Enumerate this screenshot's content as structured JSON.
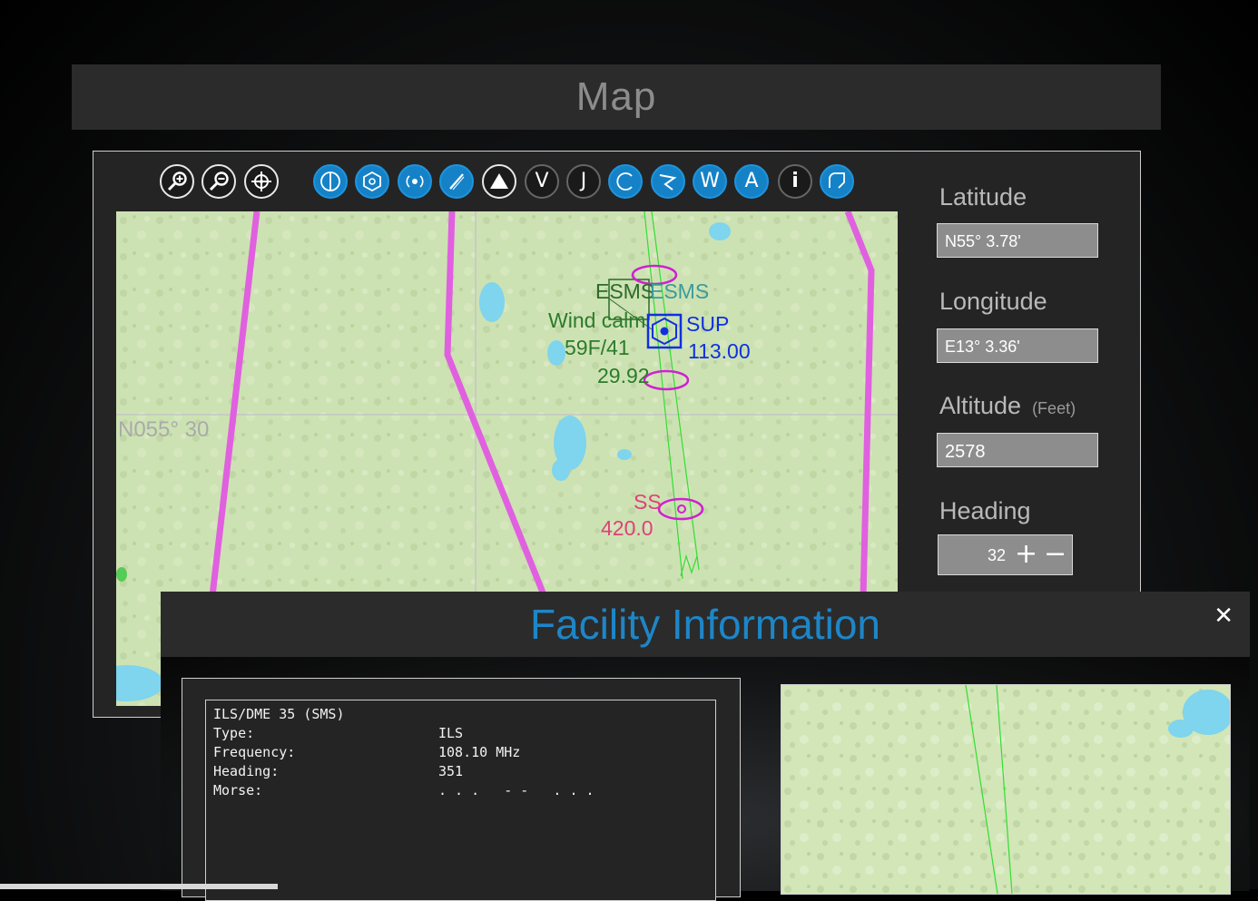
{
  "map_window": {
    "title": "Map"
  },
  "toolbar": {
    "buttons": [
      {
        "name": "zoom-in",
        "glyph": "⊕"
      },
      {
        "name": "zoom-out",
        "glyph": "⊖"
      },
      {
        "name": "center",
        "glyph": "⌖"
      },
      {
        "name": "layer-a",
        "glyph": "◐"
      },
      {
        "name": "layer-vor",
        "glyph": "⬡"
      },
      {
        "name": "layer-ndb",
        "glyph": "◉"
      },
      {
        "name": "layer-airport",
        "glyph": "✈"
      },
      {
        "name": "layer-aircraft",
        "glyph": "▲"
      },
      {
        "name": "layer-v",
        "glyph": "V"
      },
      {
        "name": "layer-j",
        "glyph": "J"
      },
      {
        "name": "layer-c",
        "glyph": "C"
      },
      {
        "name": "layer-route",
        "glyph": "⇝"
      },
      {
        "name": "layer-w",
        "glyph": "W"
      },
      {
        "name": "layer-a2",
        "glyph": "A"
      },
      {
        "name": "info",
        "glyph": "i"
      },
      {
        "name": "layer-arc",
        "glyph": "↻"
      }
    ]
  },
  "map_labels": {
    "grid_lat": "N055° 30",
    "airport_code_left": "ESMS",
    "airport_code_right": "ESMS",
    "weather_wind": "Wind calm",
    "weather_temp": "59F/41",
    "weather_pressure": "29.92",
    "vor_name": "SUP",
    "vor_freq": "113.00",
    "ndb_name": "SS",
    "ndb_freq": "420.0"
  },
  "fields": {
    "latitude": {
      "label": "Latitude",
      "value": "N55° 3.78'"
    },
    "longitude": {
      "label": "Longitude",
      "value": "E13° 3.36'"
    },
    "altitude": {
      "label": "Altitude",
      "unit": "(Feet)",
      "value": "2578"
    },
    "heading": {
      "label": "Heading",
      "value": "32",
      "plus": "+",
      "minus": "−"
    }
  },
  "facility_dialog": {
    "title": "Facility Information",
    "close": "✕",
    "header_line": "ILS/DME 35 (SMS)",
    "rows": [
      {
        "key": "Type:",
        "value": "ILS"
      },
      {
        "key": "Frequency:",
        "value": "108.10 MHz"
      },
      {
        "key": "Heading:",
        "value": "351"
      },
      {
        "key": "Morse:",
        "value": ". . .   - -   . . ."
      }
    ]
  },
  "colors": {
    "accent_blue": "#1d86c8",
    "route_magenta": "#e060e0",
    "localizer_green": "#33dd33",
    "map_land": "#c9dfb0",
    "water": "#7fd4ee"
  }
}
